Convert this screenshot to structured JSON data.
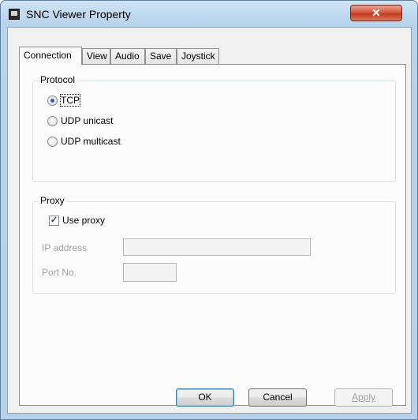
{
  "window": {
    "title": "SNC Viewer Property",
    "close_glyph": "✕"
  },
  "tabs": [
    {
      "label": "Connection",
      "active": true
    },
    {
      "label": "View",
      "active": false
    },
    {
      "label": "Audio",
      "active": false
    },
    {
      "label": "Save",
      "active": false
    },
    {
      "label": "Joystick",
      "active": false
    }
  ],
  "protocol": {
    "legend": "Protocol",
    "options": [
      {
        "label": "TCP",
        "selected": true
      },
      {
        "label": "UDP unicast",
        "selected": false
      },
      {
        "label": "UDP multicast",
        "selected": false
      }
    ]
  },
  "proxy": {
    "legend": "Proxy",
    "use_proxy_label": "Use proxy",
    "use_proxy_checked": true,
    "check_glyph": "✓",
    "ip_label": "IP address",
    "ip_value": "",
    "port_label": "Port No.",
    "port_value": ""
  },
  "buttons": {
    "ok": "OK",
    "cancel": "Cancel",
    "apply": "Apply"
  },
  "icons": {
    "app": "app-window-icon",
    "close": "close-icon",
    "radio": "radio-icon",
    "checkbox": "checkbox-icon"
  }
}
